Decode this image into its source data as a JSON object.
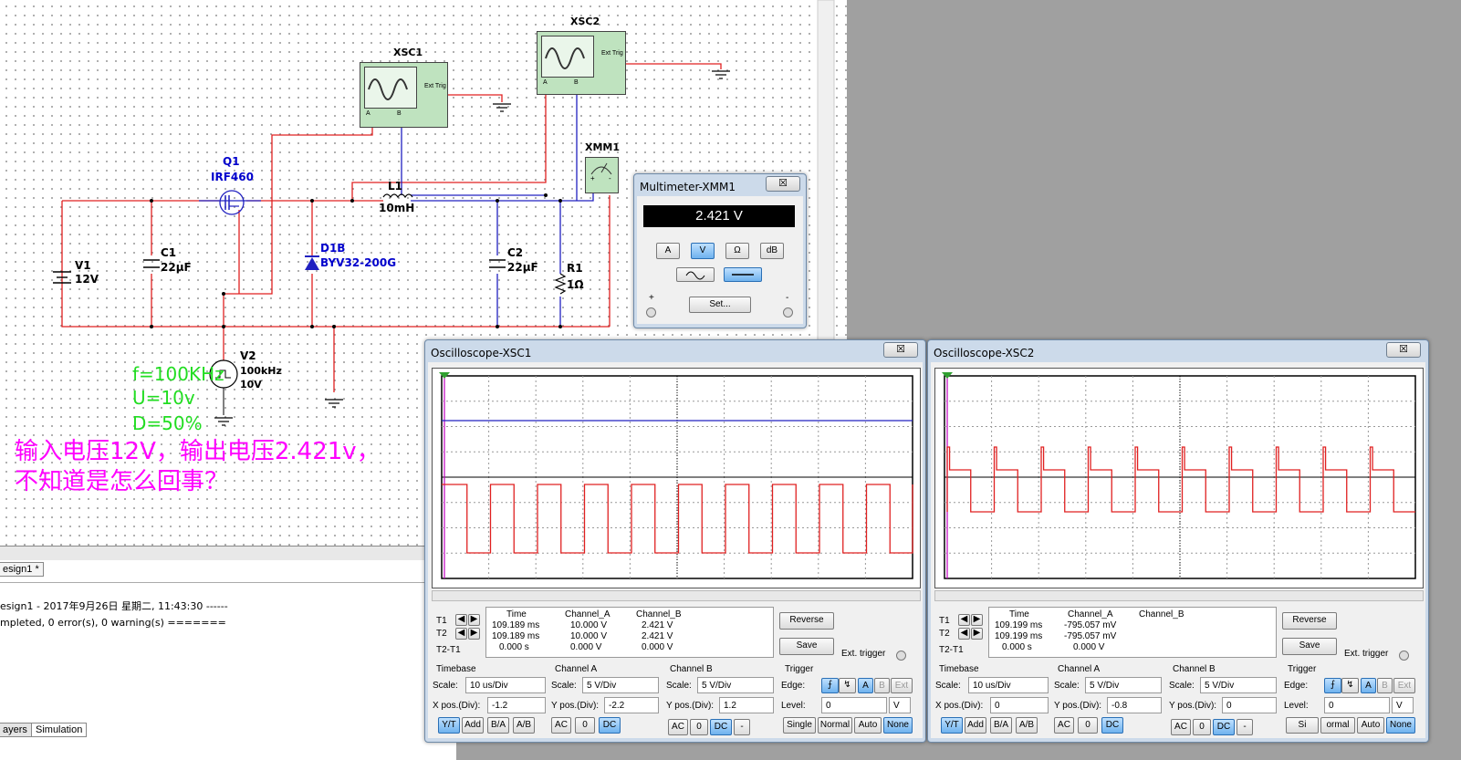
{
  "schematic": {
    "components": {
      "q1_ref": "Q1",
      "q1_part": "IRF460",
      "l1_ref": "L1",
      "l1_val": "10mH",
      "c1_ref": "C1",
      "c1_val": "22μF",
      "c2_ref": "C2",
      "c2_val": "22μF",
      "d1_ref": "D1B",
      "d1_part": "BYV32-200G",
      "v1_ref": "V1",
      "v1_val": "12V",
      "v2_ref": "V2",
      "v2_freq": "100kHz",
      "v2_amp": "10V",
      "r1_ref": "R1",
      "r1_val": "1Ω",
      "xsc1": "XSC1",
      "xsc2": "XSC2",
      "xmm1": "XMM1",
      "ext_trig": "Ext Trig",
      "port_a": "A",
      "port_b": "B",
      "plus": "+",
      "minus": "-"
    },
    "params": [
      "f=100KHz",
      "U=10v",
      "D=50%"
    ],
    "note_line1": "输入电压12V，输出电压2.421v，",
    "note_line2": "不知道是怎么回事？"
  },
  "bottom_panel": {
    "tab_design": "esign1 *",
    "log_line1": "esign1 - 2017年9月26日 星期二, 11:43:30 ------",
    "log_line2": "mpleted, 0 error(s), 0 warning(s) =======",
    "tab_layers": "ayers",
    "tab_simulation": "Simulation"
  },
  "multimeter": {
    "title": "Multimeter-XMM1",
    "close": "☒",
    "reading": "2.421 V",
    "buttons": [
      "A",
      "V",
      "Ω",
      "dB"
    ],
    "active": "V",
    "set_label": "Set...",
    "plus": "+",
    "minus": "-"
  },
  "osc1": {
    "title": "Oscilloscope-XSC1",
    "close": "☒",
    "hdr_time": "Time",
    "hdr_a": "Channel_A",
    "hdr_b": "Channel_B",
    "rows": [
      {
        "label": "T1",
        "time": "109.189 ms",
        "a": "10.000 V",
        "b": "2.421 V"
      },
      {
        "label": "T2",
        "time": "109.189 ms",
        "a": "10.000 V",
        "b": "2.421 V"
      },
      {
        "label": "T2-T1",
        "time": "0.000 s",
        "a": "0.000 V",
        "b": "0.000 V"
      }
    ],
    "reverse": "Reverse",
    "save": "Save",
    "ext_trigger": "Ext. trigger",
    "timebase": "Timebase",
    "scale": "Scale:",
    "tb_scale": "10 us/Div",
    "xpos_label": "X pos.(Div):",
    "xpos": "-1.2",
    "cha": "Channel A",
    "cha_scale": "5  V/Div",
    "ypos_label": "Y pos.(Div):",
    "cha_ypos": "-2.2",
    "chb": "Channel B",
    "chb_scale": "5  V/Div",
    "chb_ypos": "1.2",
    "trigger": "Trigger",
    "edge": "Edge:",
    "level": "Level:",
    "level_val": "0",
    "level_unit": "V",
    "mode_btns": [
      "Y/T",
      "Add",
      "B/A",
      "A/B"
    ],
    "coupling": [
      "AC",
      "0",
      "DC"
    ],
    "coupling_b": [
      "AC",
      "0",
      "DC",
      "-"
    ],
    "trig_src": [
      "A",
      "B",
      "Ext"
    ],
    "trig_modes": [
      "Single",
      "Normal",
      "Auto",
      "None"
    ]
  },
  "osc2": {
    "title": "Oscilloscope-XSC2",
    "close": "☒",
    "hdr_time": "Time",
    "hdr_a": "Channel_A",
    "hdr_b": "Channel_B",
    "rows": [
      {
        "label": "T1",
        "time": "109.199 ms",
        "a": "-795.057 mV",
        "b": ""
      },
      {
        "label": "T2",
        "time": "109.199 ms",
        "a": "-795.057 mV",
        "b": ""
      },
      {
        "label": "T2-T1",
        "time": "0.000 s",
        "a": "0.000 V",
        "b": ""
      }
    ],
    "reverse": "Reverse",
    "save": "Save",
    "ext_trigger": "Ext. trigger",
    "timebase": "Timebase",
    "scale": "Scale:",
    "tb_scale": "10 us/Div",
    "xpos_label": "X pos.(Div):",
    "xpos": "0",
    "cha": "Channel A",
    "cha_scale": "5  V/Div",
    "ypos_label": "Y pos.(Div):",
    "cha_ypos": "-0.8",
    "chb": "Channel B",
    "chb_scale": "5  V/Div",
    "chb_ypos": "0",
    "trigger": "Trigger",
    "edge": "Edge:",
    "level": "Level:",
    "level_val": "0",
    "level_unit": "V",
    "mode_btns": [
      "Y/T",
      "Add",
      "B/A",
      "A/B"
    ],
    "coupling": [
      "AC",
      "0",
      "DC"
    ],
    "coupling_b": [
      "AC",
      "0",
      "DC",
      "-"
    ],
    "trig_src": [
      "A",
      "B",
      "Ext"
    ],
    "trig_modes": [
      "Si",
      "ormal",
      "Auto",
      "None"
    ]
  },
  "colors": {
    "wire_red": "#e02020",
    "wire_blue": "#2020c0",
    "trace_a": "#e02020",
    "trace_b": "#2020c0"
  }
}
